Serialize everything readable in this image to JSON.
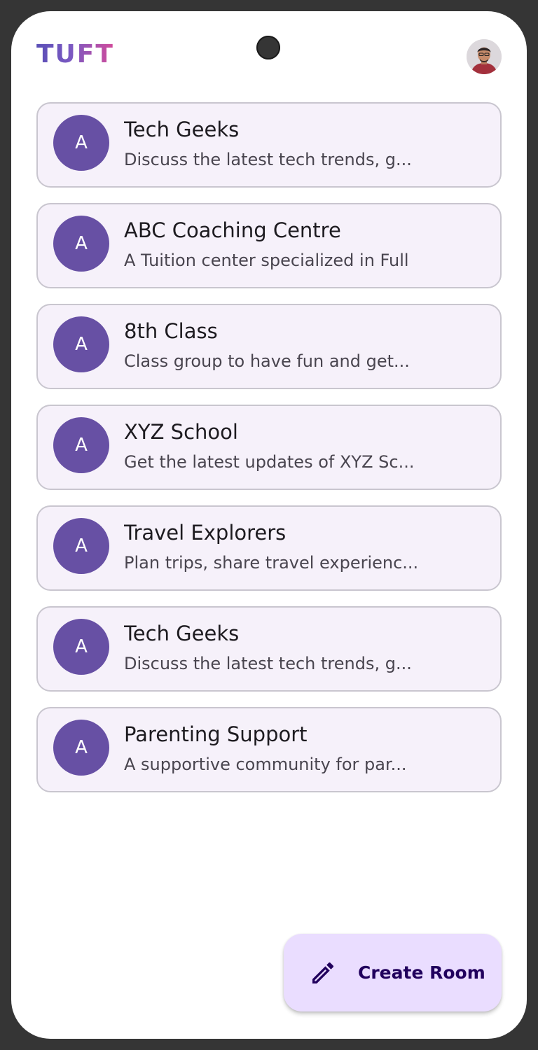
{
  "app": {
    "logo_text": "TUFT",
    "logo_gradient": [
      "#5a4fb6",
      "#d24a9a"
    ]
  },
  "profile": {
    "icon": "user-avatar-icon"
  },
  "rooms": [
    {
      "initial": "A",
      "title": "Tech Geeks",
      "description": "Discuss the latest tech trends, g..."
    },
    {
      "initial": "A",
      "title": "ABC Coaching Centre",
      "description": "A Tuition center specialized in Full"
    },
    {
      "initial": "A",
      "title": "8th Class",
      "description": "Class group to have fun and get..."
    },
    {
      "initial": "A",
      "title": "XYZ School",
      "description": "Get the latest updates of XYZ Sc..."
    },
    {
      "initial": "A",
      "title": "Travel Explorers",
      "description": "Plan trips, share travel experienc..."
    },
    {
      "initial": "A",
      "title": "Tech Geeks",
      "description": "Discuss the latest tech trends, g..."
    },
    {
      "initial": "A",
      "title": "Parenting Support",
      "description": "A supportive community for par..."
    }
  ],
  "fab": {
    "label": "Create Room",
    "icon": "pencil-icon"
  },
  "colors": {
    "avatar_bg": "#6750a4",
    "card_bg": "#f6f1fa",
    "fab_bg": "#eaddff",
    "fab_text": "#21005d"
  }
}
